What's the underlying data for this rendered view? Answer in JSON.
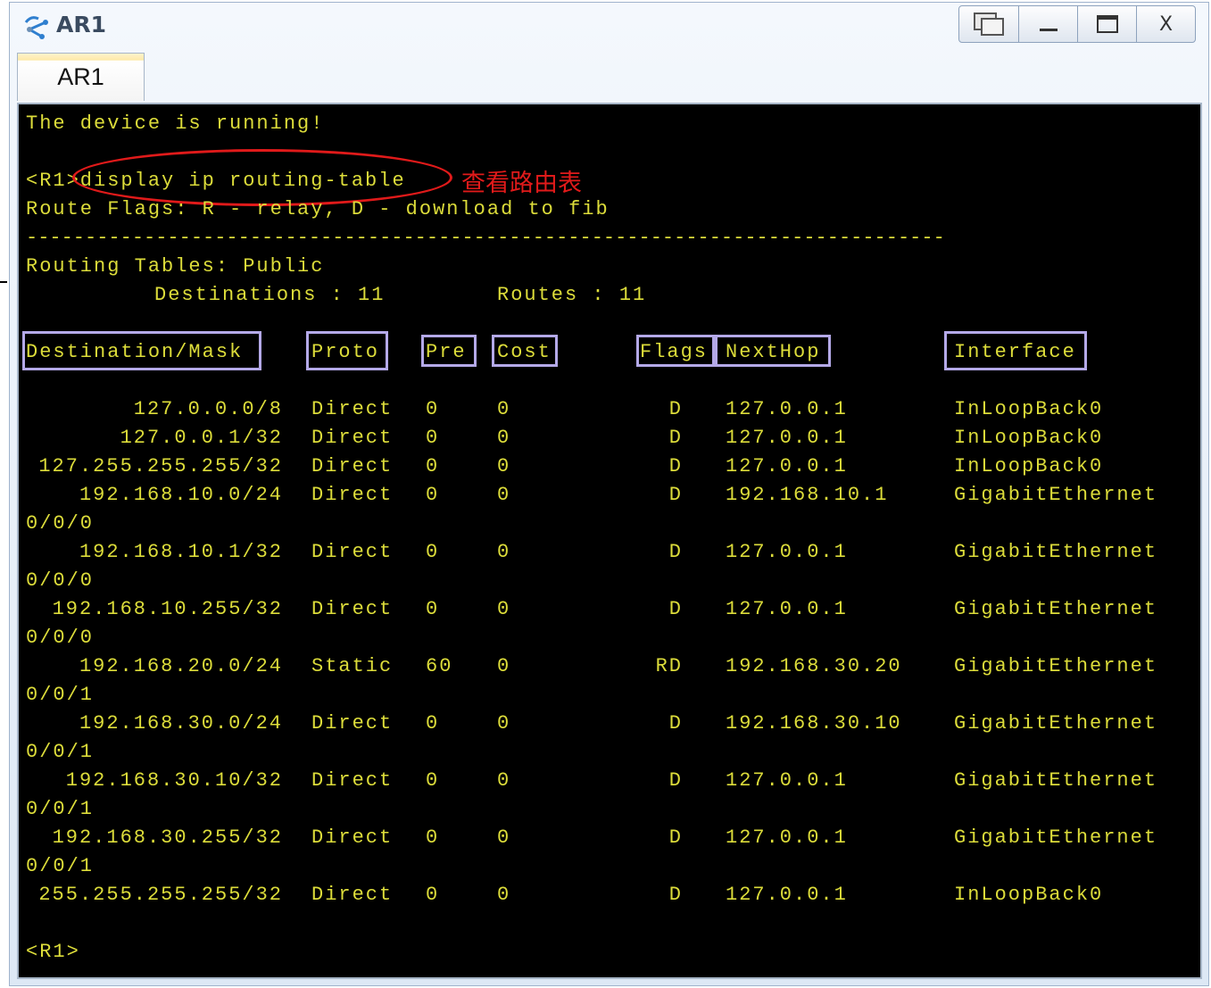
{
  "window": {
    "title": "AR1",
    "controls": [
      "restore-window",
      "minimize",
      "maximize",
      "close"
    ],
    "close_glyph": "X"
  },
  "tab": {
    "label": "AR1"
  },
  "terminal": {
    "status_line": "The device is running!",
    "prompt_command": "<R1>display ip routing-table",
    "annotation": "查看路由表",
    "flags_line": "Route Flags: R - relay, D - download to fib",
    "separator": "------------------------------------------------------------------------------",
    "tables_line": "Routing Tables: Public",
    "destinations_label": "Destinations : 11",
    "routes_label": "Routes : 11",
    "headers": {
      "destination": "Destination/Mask",
      "proto": "Proto",
      "pre": "Pre",
      "cost": "Cost",
      "flags": "Flags",
      "nexthop": "NextHop",
      "interface": "Interface"
    },
    "routes": [
      {
        "dest": "127.0.0.0/8",
        "proto": "Direct",
        "pre": "0",
        "cost": "0",
        "flags": "D",
        "nexthop": "127.0.0.1",
        "iface": "InLoopBack0",
        "iface_cont": ""
      },
      {
        "dest": "127.0.0.1/32",
        "proto": "Direct",
        "pre": "0",
        "cost": "0",
        "flags": "D",
        "nexthop": "127.0.0.1",
        "iface": "InLoopBack0",
        "iface_cont": ""
      },
      {
        "dest": "127.255.255.255/32",
        "proto": "Direct",
        "pre": "0",
        "cost": "0",
        "flags": "D",
        "nexthop": "127.0.0.1",
        "iface": "InLoopBack0",
        "iface_cont": ""
      },
      {
        "dest": "192.168.10.0/24",
        "proto": "Direct",
        "pre": "0",
        "cost": "0",
        "flags": "D",
        "nexthop": "192.168.10.1",
        "iface": "GigabitEthernet",
        "iface_cont": "0/0/0"
      },
      {
        "dest": "192.168.10.1/32",
        "proto": "Direct",
        "pre": "0",
        "cost": "0",
        "flags": "D",
        "nexthop": "127.0.0.1",
        "iface": "GigabitEthernet",
        "iface_cont": "0/0/0"
      },
      {
        "dest": "192.168.10.255/32",
        "proto": "Direct",
        "pre": "0",
        "cost": "0",
        "flags": "D",
        "nexthop": "127.0.0.1",
        "iface": "GigabitEthernet",
        "iface_cont": "0/0/0"
      },
      {
        "dest": "192.168.20.0/24",
        "proto": "Static",
        "pre": "60",
        "cost": "0",
        "flags": "RD",
        "nexthop": "192.168.30.20",
        "iface": "GigabitEthernet",
        "iface_cont": "0/0/1"
      },
      {
        "dest": "192.168.30.0/24",
        "proto": "Direct",
        "pre": "0",
        "cost": "0",
        "flags": "D",
        "nexthop": "192.168.30.10",
        "iface": "GigabitEthernet",
        "iface_cont": "0/0/1"
      },
      {
        "dest": "192.168.30.10/32",
        "proto": "Direct",
        "pre": "0",
        "cost": "0",
        "flags": "D",
        "nexthop": "127.0.0.1",
        "iface": "GigabitEthernet",
        "iface_cont": "0/0/1"
      },
      {
        "dest": "192.168.30.255/32",
        "proto": "Direct",
        "pre": "0",
        "cost": "0",
        "flags": "D",
        "nexthop": "127.0.0.1",
        "iface": "GigabitEthernet",
        "iface_cont": "0/0/1"
      },
      {
        "dest": "255.255.255.255/32",
        "proto": "Direct",
        "pre": "0",
        "cost": "0",
        "flags": "D",
        "nexthop": "127.0.0.1",
        "iface": "InLoopBack0",
        "iface_cont": ""
      }
    ],
    "final_prompt": "<R1>"
  },
  "colors": {
    "terminal_bg": "#000000",
    "terminal_text": "#dcdc3a",
    "annotation": "#e01a1a",
    "header_box": "#b4a9e8"
  }
}
